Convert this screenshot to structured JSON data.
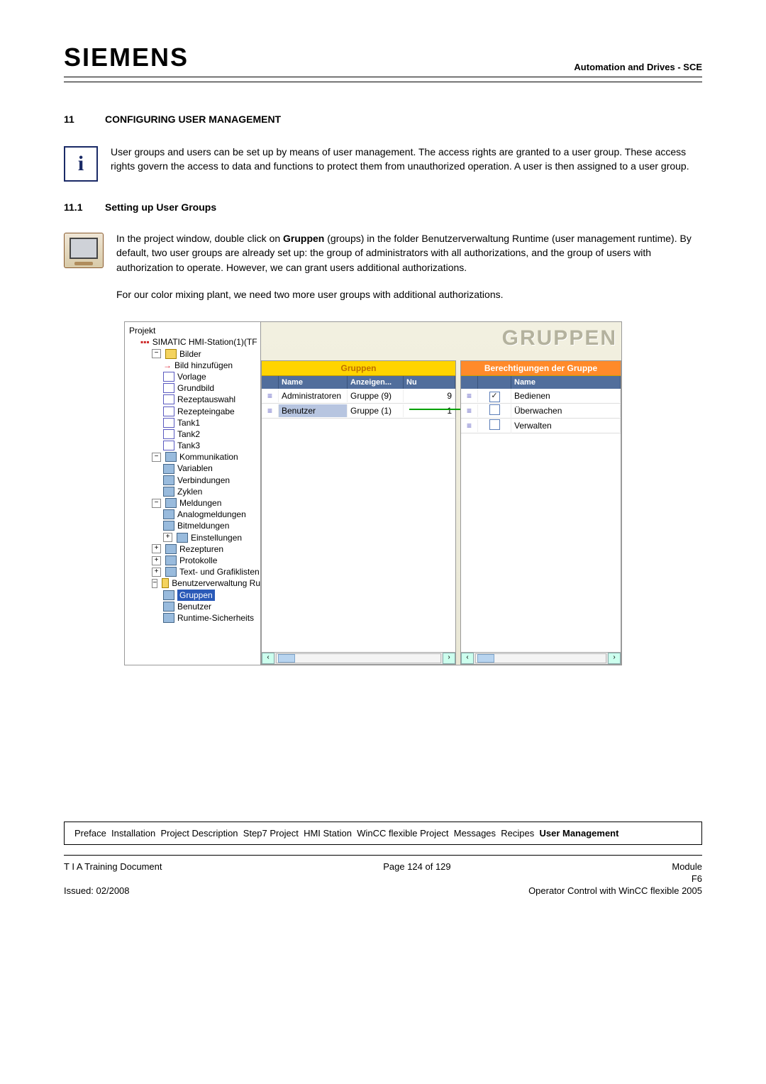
{
  "header": {
    "logo": "SIEMENS",
    "right": "Automation and Drives - SCE"
  },
  "section": {
    "num": "11",
    "title": "CONFIGURING USER MANAGEMENT"
  },
  "intro": "User groups and users can be set up by means of user management. The access rights are granted to a user group. These access rights govern the access to data and functions to protect them from unauthorized operation. A user is then assigned to a user group.",
  "subsection": {
    "num": "11.1",
    "title": "Setting up User Groups"
  },
  "para1a": "In the project window, double click on ",
  "para1b": "Gruppen",
  "para1c": " (groups) in the folder Benutzerverwaltung Runtime (user management runtime). By default, two user groups are already set up: the group of administrators with all authorizations, and the group of users with authorization to operate. However, we can grant users additional authorizations.",
  "para2": "For our color mixing plant, we need two more user groups with additional authorizations.",
  "tree": {
    "root": "Projekt",
    "station": "SIMATIC HMI-Station(1)(TF",
    "bilder": "Bilder",
    "bilder_items": [
      "Bild hinzufügen",
      "Vorlage",
      "Grundbild",
      "Rezeptauswahl",
      "Rezepteingabe",
      "Tank1",
      "Tank2",
      "Tank3"
    ],
    "komm": "Kommunikation",
    "komm_items": [
      "Variablen",
      "Verbindungen",
      "Zyklen"
    ],
    "meld": "Meldungen",
    "meld_items": [
      "Analogmeldungen",
      "Bitmeldungen",
      "Einstellungen"
    ],
    "rezepturen": "Rezepturen",
    "protokolle": "Protokolle",
    "textgraf": "Text- und Grafiklisten",
    "benutzer": "Benutzerverwaltung Ru",
    "benutzer_items": [
      "Gruppen",
      "Benutzer",
      "Runtime-Sicherheits"
    ]
  },
  "banner": "GRUPPEN",
  "groups_panel": {
    "title": "Gruppen",
    "head": [
      "Name",
      "Anzeigen...",
      "Nu"
    ],
    "rows": [
      {
        "name": "Administratoren",
        "anzeigen": "Gruppe (9)",
        "nu": "9"
      },
      {
        "name": "Benutzer",
        "anzeigen": "Gruppe (1)",
        "nu": "1"
      }
    ]
  },
  "perms_panel": {
    "title": "Berechtigungen der Gruppe",
    "head": "Name",
    "rows": [
      {
        "checked": true,
        "name": "Bedienen"
      },
      {
        "checked": false,
        "name": "Überwachen"
      },
      {
        "checked": false,
        "name": "Verwalten"
      }
    ]
  },
  "breadcrumb": {
    "items": [
      "Preface",
      "Installation",
      "Project Description",
      "Step7 Project",
      "HMI Station",
      "WinCC flexible Project",
      "Messages",
      "Recipes"
    ],
    "active": "User Management"
  },
  "footer": {
    "left1": "T I A  Training Document",
    "center1": "Page 124 of 129",
    "right1": "Module",
    "right1b": "F6",
    "left2": "Issued: 02/2008",
    "right2": "Operator Control with WinCC flexible 2005"
  }
}
